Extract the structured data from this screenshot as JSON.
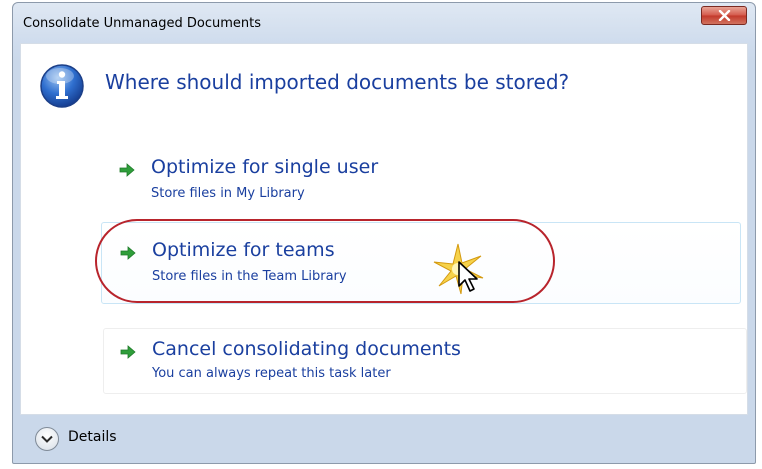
{
  "window": {
    "title": "Consolidate Unmanaged Documents"
  },
  "main": {
    "instruction": "Where should imported documents be stored?",
    "icon": "info-icon"
  },
  "options": [
    {
      "title": "Optimize for single user",
      "subtitle": "Store files in My Library",
      "icon": "green-arrow-icon"
    },
    {
      "title": "Optimize for teams",
      "subtitle": "Store files in the Team Library",
      "icon": "green-arrow-icon",
      "highlighted": true
    },
    {
      "title": "Cancel consolidating documents",
      "subtitle": "You can always repeat this task later",
      "icon": "green-arrow-icon"
    }
  ],
  "footer": {
    "details_label": "Details"
  },
  "colors": {
    "accent_text": "#1a3f9f",
    "arrow_green": "#2f9e3a",
    "highlight_oval": "#b8242c",
    "close_button": "#c3382a"
  }
}
